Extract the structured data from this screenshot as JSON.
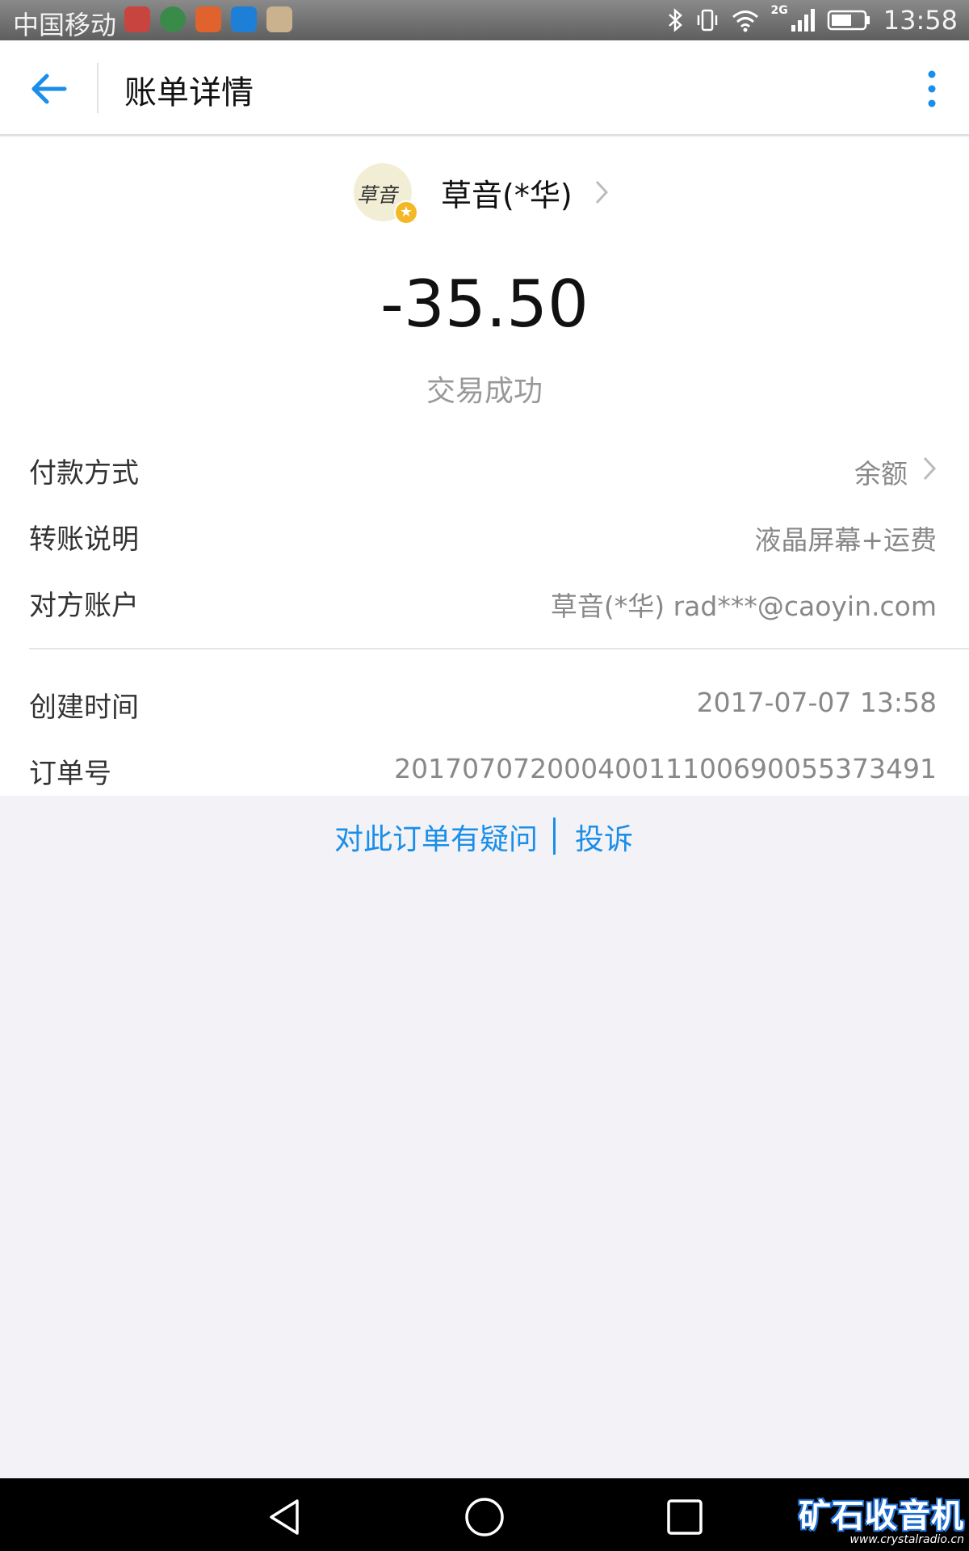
{
  "status_bar": {
    "carrier": "中国移动",
    "network": "2G",
    "time": "13:58",
    "app_icon_colors": [
      "#c8443f",
      "#3a8a4a",
      "#e0622c",
      "#1d7fd6",
      "#c9b28d"
    ]
  },
  "header": {
    "title": "账单详情",
    "back_icon": "arrow-left-icon",
    "more_icon": "more-vertical-icon"
  },
  "payee": {
    "avatar_text": "草音",
    "badge_symbol": "★",
    "name": "草音(*华)"
  },
  "amount": "-35.50",
  "status": "交易成功",
  "details": [
    {
      "label": "付款方式",
      "value": "余额",
      "has_arrow": true
    },
    {
      "label": "转账说明",
      "value": "液晶屏幕+运费"
    },
    {
      "label": "对方账户",
      "value": "草音(*华) rad***@caoyin.com"
    },
    {
      "label": "创建时间",
      "value": "2017-07-07 13:58"
    },
    {
      "label": "订单号",
      "value": "20170707200040011100690055373491"
    }
  ],
  "links": {
    "doubt": "对此订单有疑问",
    "complain": "投诉"
  },
  "watermark": {
    "title": "矿石收音机",
    "url": "www.crystalradio.cn"
  },
  "colors": {
    "accent": "#1a8ee8",
    "background": "#f3f3f7"
  }
}
